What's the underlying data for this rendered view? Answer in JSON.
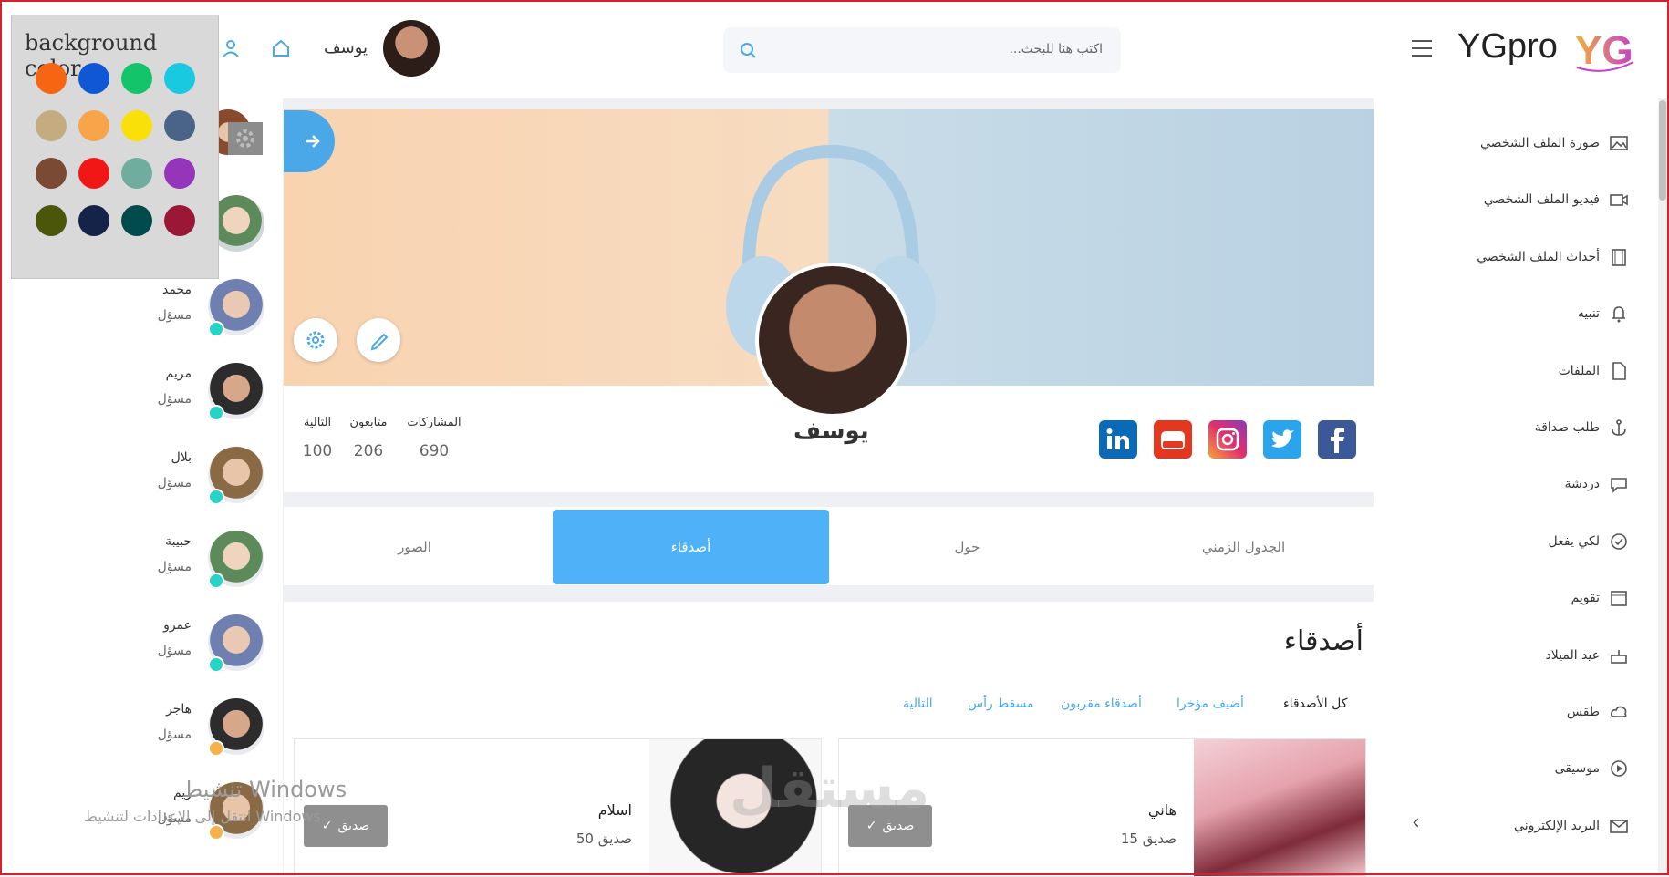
{
  "brand": {
    "name": "YGpro",
    "logo_text": "YG"
  },
  "search": {
    "placeholder": "اكتب هنا للبحث..."
  },
  "user": {
    "name": "يوسف"
  },
  "color_picker": {
    "title": "background color",
    "colors": [
      "#f56512",
      "#1057d6",
      "#14c46b",
      "#19c9e0",
      "#c4ac80",
      "#f7a44a",
      "#f8e008",
      "#4a6489",
      "#7a4a34",
      "#f21717",
      "#6fae9e",
      "#9535b9",
      "#4c560b",
      "#152349",
      "#014b4d",
      "#9a1836"
    ]
  },
  "contacts": [
    {
      "name": "محمد",
      "role": "مسؤل",
      "status_color": "#27d3c4"
    },
    {
      "name": "مريم",
      "role": "مسؤل",
      "status_color": "#27d3c4"
    },
    {
      "name": "بلال",
      "role": "مسؤل",
      "status_color": "#27d3c4"
    },
    {
      "name": "حبيبة",
      "role": "مسؤل",
      "status_color": "#27d3c4"
    },
    {
      "name": "عمرو",
      "role": "مسؤل",
      "status_color": "#27d3c4"
    },
    {
      "name": "هاجر",
      "role": "مسؤل",
      "status_color": "#f7b14a"
    },
    {
      "name": "ريم",
      "role": "مسؤل",
      "status_color": "#f7b14a"
    }
  ],
  "profile": {
    "name": "يوسف",
    "stats": [
      {
        "label": "المشاركات",
        "value": "690"
      },
      {
        "label": "متابعون",
        "value": "206"
      },
      {
        "label": "التالية",
        "value": "100"
      }
    ],
    "social": [
      "facebook-icon",
      "twitter-icon",
      "instagram-icon",
      "youtube-icon",
      "linkedin-icon"
    ]
  },
  "tabs": [
    {
      "label": "الجدول الزمني"
    },
    {
      "label": "حول"
    },
    {
      "label": "أصدقاء"
    },
    {
      "label": "الصور"
    }
  ],
  "friends": {
    "title": "أصدقاء",
    "filters": [
      "كل الأصدقاء",
      "أضيف مؤخرا",
      "أصدقاء مقربون",
      "مسقط رأس",
      "التالية"
    ],
    "cards": [
      {
        "name": "هاني",
        "count": "15 صديق",
        "button": "صديق"
      },
      {
        "name": "اسلام",
        "count": "50 صديق",
        "button": "صديق"
      }
    ]
  },
  "sidebar": {
    "items": [
      "صورة الملف الشخصي",
      "فيديو الملف الشخصي",
      "أحداث الملف الشخصي",
      "تنبيه",
      "الملفات",
      "طلب صداقة",
      "دردشة",
      "لكي يفعل",
      "تقويم",
      "عيد الميلاد",
      "طقس",
      "موسيقى",
      "البريد الإلكتروني"
    ]
  },
  "watermark": {
    "line1": "تنشيط Windows",
    "line2": "انتقل إلى الإعدادات لتنشيط Windows.",
    "brand": "مستقل"
  },
  "accent": "#4fb2f8"
}
